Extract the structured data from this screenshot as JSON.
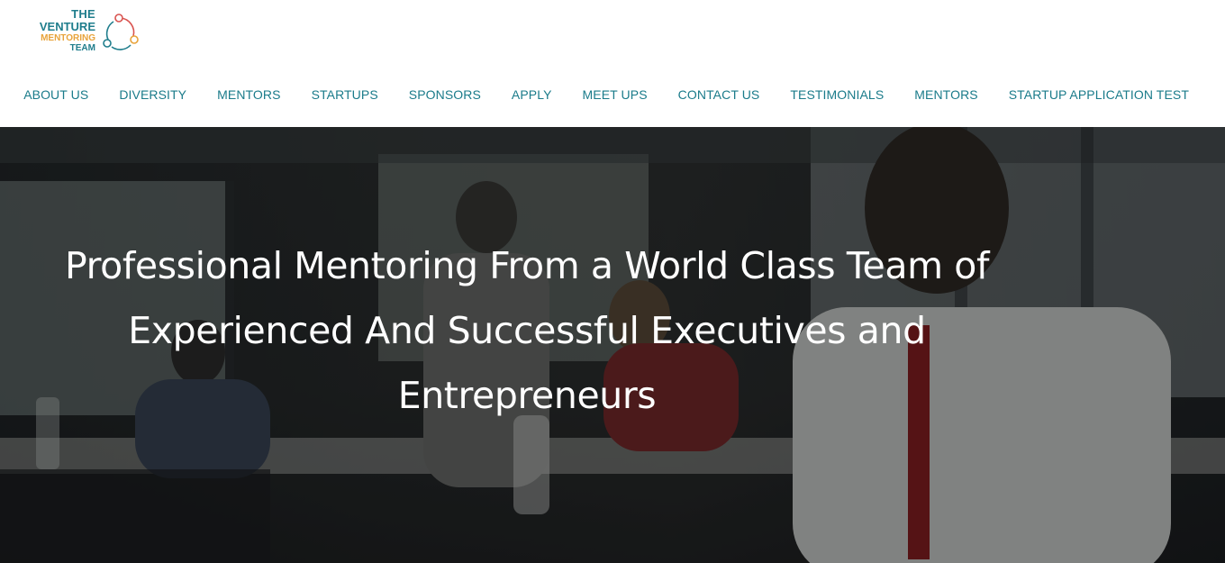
{
  "logo": {
    "line1": "THE",
    "line2": "VENTURE",
    "line3": "MENTORING",
    "line4": "TEAM",
    "colors": {
      "teal": "#1f7d8c",
      "orange": "#e8a33a",
      "red": "#d9534f"
    }
  },
  "nav": {
    "items": [
      {
        "label": "ABOUT US"
      },
      {
        "label": "DIVERSITY"
      },
      {
        "label": "MENTORS"
      },
      {
        "label": "STARTUPS"
      },
      {
        "label": "SPONSORS"
      },
      {
        "label": "APPLY"
      },
      {
        "label": "MEET UPS"
      },
      {
        "label": "CONTACT US"
      },
      {
        "label": "TESTIMONIALS"
      },
      {
        "label": "MENTORS"
      },
      {
        "label": "STARTUP APPLICATION TEST"
      }
    ],
    "color": "#1a7b8a"
  },
  "hero": {
    "headline": "Professional Mentoring From a World Class Team of Experienced And Successful Executives and Entrepreneurs"
  }
}
